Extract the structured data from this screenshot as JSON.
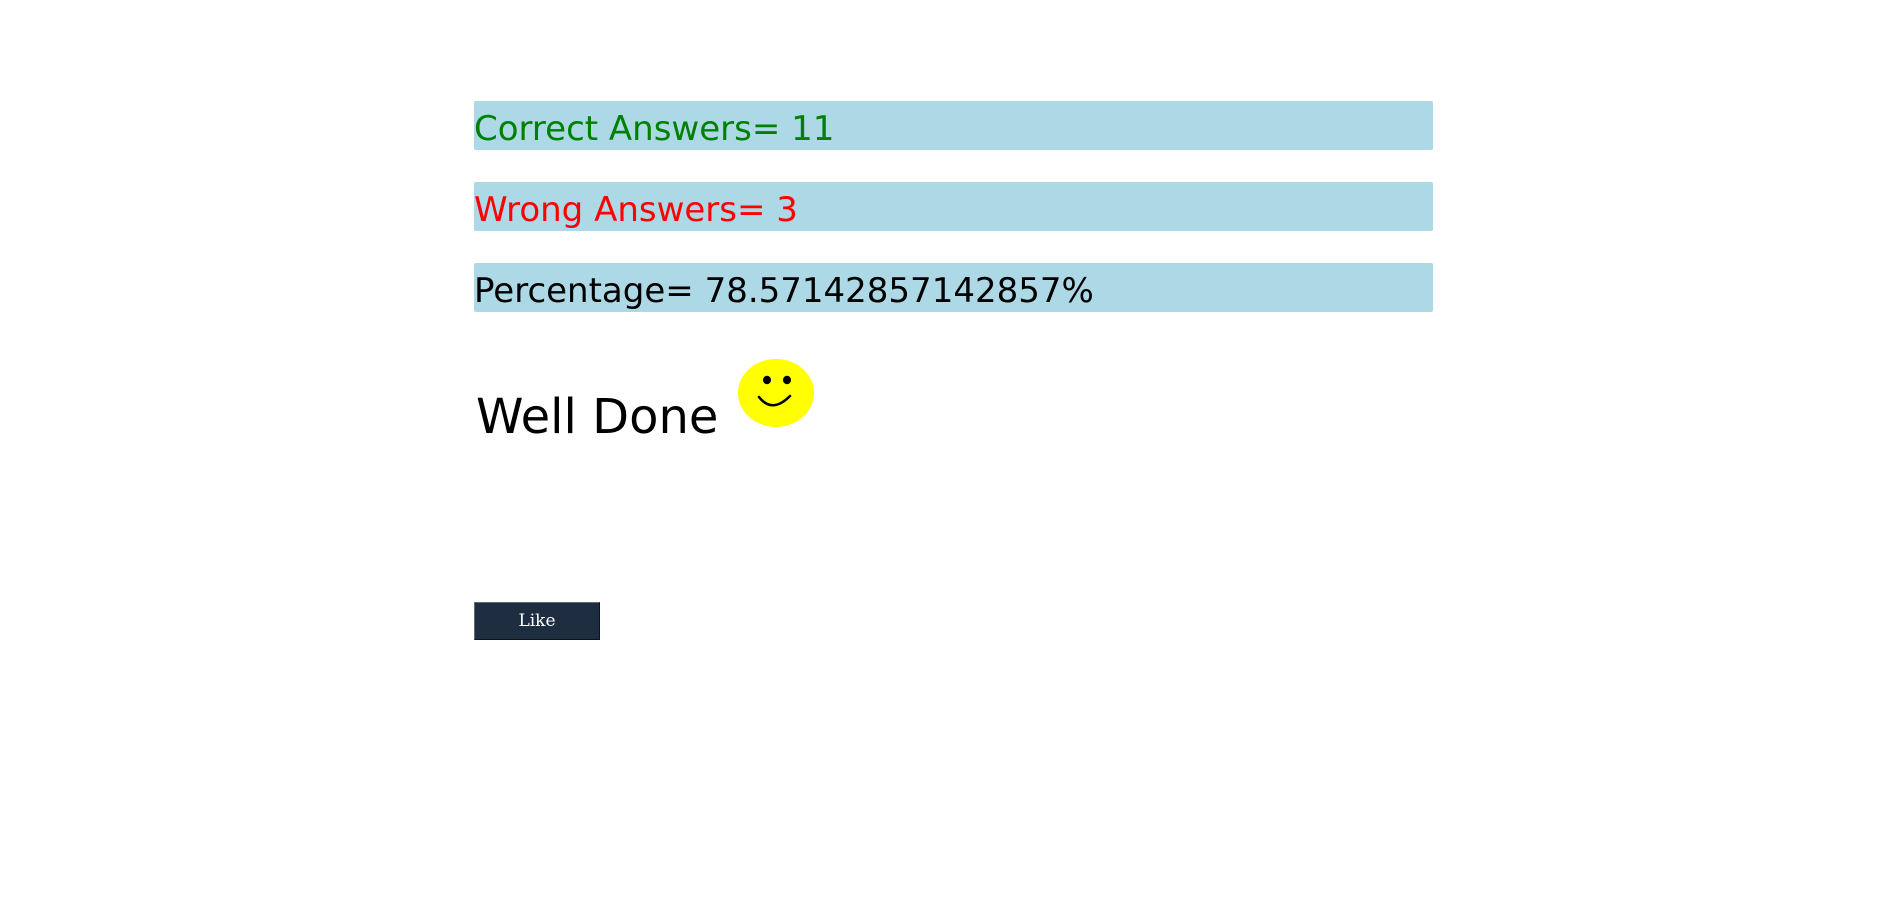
{
  "results": {
    "correct": "Correct Answers= 11",
    "wrong": "Wrong Answers= 3",
    "percentage": "Percentage= 78.57142857142857%"
  },
  "feedback": {
    "message": "Well Done",
    "icon": "smiley-face-icon"
  },
  "actions": {
    "like_label": "Like"
  },
  "colors": {
    "row_background": "#add8e6",
    "correct_text": "#008000",
    "wrong_text": "#ff0000",
    "smiley_fill": "#ffff00",
    "button_background": "#1f2d40"
  }
}
